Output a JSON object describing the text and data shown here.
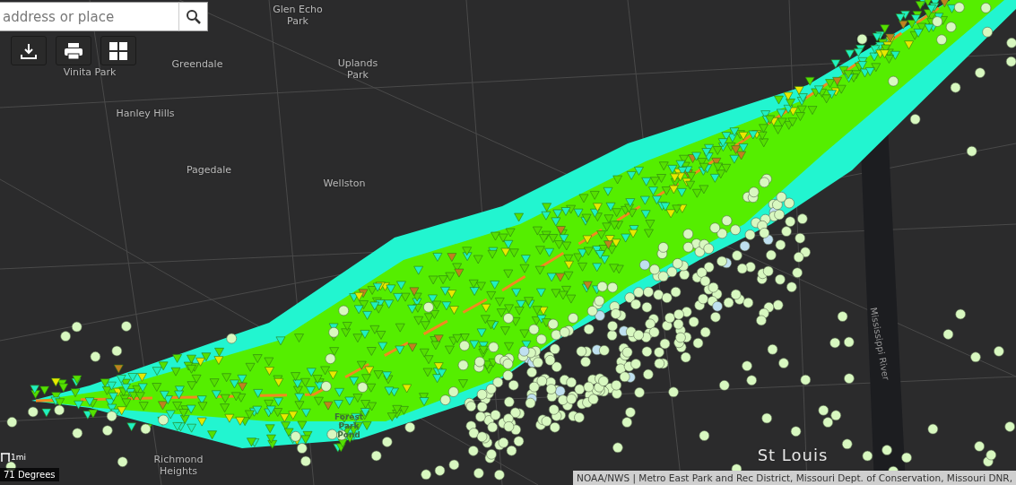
{
  "search": {
    "placeholder": "address or place"
  },
  "toolbar": [
    {
      "kind": "download"
    },
    {
      "kind": "print"
    },
    {
      "kind": "grid"
    }
  ],
  "place_labels": [
    {
      "text": "Glen Echo\nPark"
    },
    {
      "text": "Vinita Park"
    },
    {
      "text": "Greendale"
    },
    {
      "text": "Uplands\nPark"
    },
    {
      "text": "Hanley Hills"
    },
    {
      "text": "Pagedale"
    },
    {
      "text": "Wellston"
    },
    {
      "text": "Richmond\nHeights"
    },
    {
      "text": "St Louis"
    },
    {
      "text": "Forest\nPark\nPond"
    }
  ],
  "river_label": "Mississippi River",
  "scale": {
    "label": "1mi"
  },
  "coordinates": "71 Degrees",
  "attribution": "NOAA/NWS | Metro East Park and Rec District, Missouri Dept. of Conservation, Missouri DNR,"
}
